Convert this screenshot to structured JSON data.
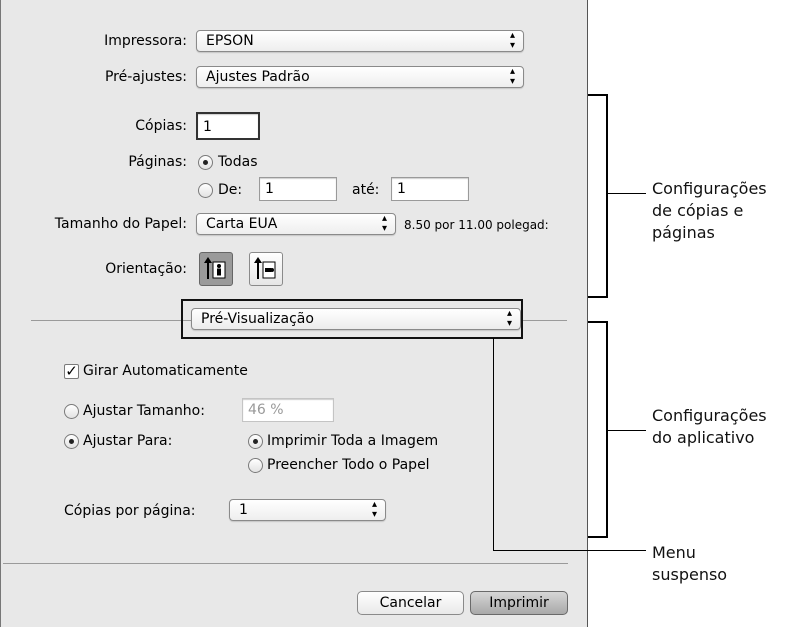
{
  "printer": {
    "label": "Impressora:",
    "value": "EPSON"
  },
  "presets": {
    "label": "Pré-ajustes:",
    "value": "Ajustes Padrão"
  },
  "copies": {
    "label": "Cópias:",
    "value": "1"
  },
  "pages": {
    "label": "Páginas:",
    "all_label": "Todas",
    "from_label": "De:",
    "from_value": "1",
    "to_label": "até:",
    "to_value": "1"
  },
  "paper_size": {
    "label": "Tamanho do Papel:",
    "value": "Carta EUA",
    "dimensions": "8.50 por 11.00 polegad:"
  },
  "orientation": {
    "label": "Orientação:"
  },
  "section_menu": {
    "value": "Pré-Visualização"
  },
  "auto_rotate": {
    "label": "Girar Automaticamente",
    "checked": true
  },
  "scale": {
    "label": "Ajustar Tamanho:",
    "value": "46 %"
  },
  "fit": {
    "label": "Ajustar Para:",
    "option_print_entire": "Imprimir Toda a Imagem",
    "option_fill_paper": "Preencher Todo o Papel"
  },
  "copies_per_page": {
    "label": "Cópias por página:",
    "value": "1"
  },
  "buttons": {
    "cancel": "Cancelar",
    "print": "Imprimir"
  },
  "callouts": {
    "copies_pages": [
      "Configurações",
      "de cópias e",
      "páginas"
    ],
    "app_settings": [
      "Configurações",
      "do aplicativo"
    ],
    "menu": [
      "Menu",
      "suspenso"
    ]
  },
  "icons": {
    "popup_arrows": "up-down-chevron-icon",
    "portrait": "portrait-orientation-icon",
    "landscape": "landscape-orientation-icon"
  }
}
